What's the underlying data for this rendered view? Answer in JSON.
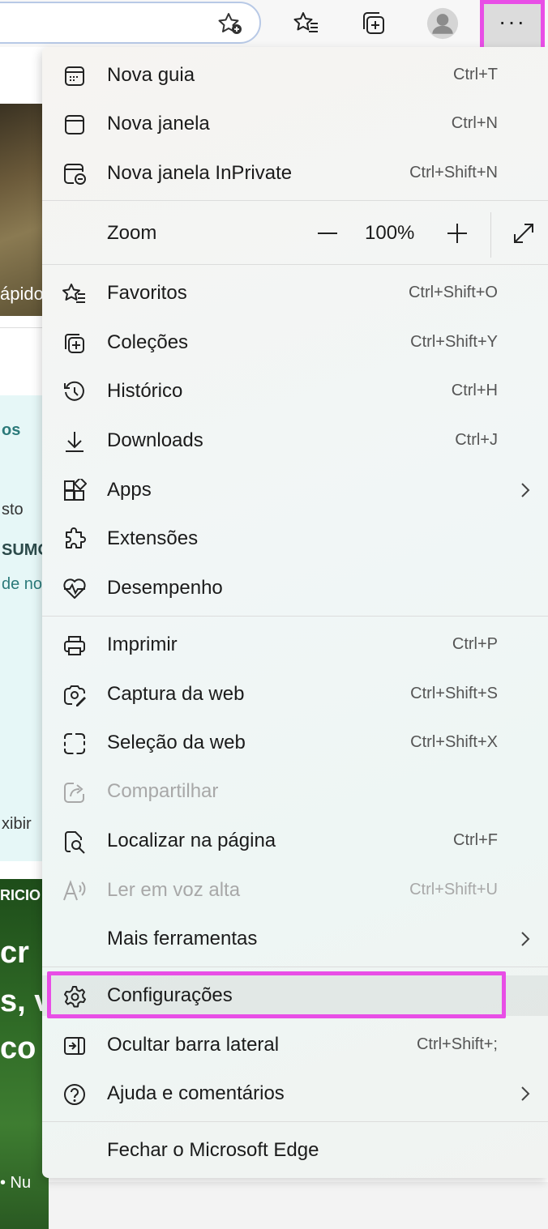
{
  "menu": {
    "items": [
      {
        "label": "Nova guia",
        "shortcut": "Ctrl+T",
        "icon": "new-tab-icon"
      },
      {
        "label": "Nova janela",
        "shortcut": "Ctrl+N",
        "icon": "new-window-icon"
      },
      {
        "label": "Nova janela InPrivate",
        "shortcut": "Ctrl+Shift+N",
        "icon": "inprivate-window-icon"
      }
    ],
    "zoom": {
      "label": "Zoom",
      "value": "100%",
      "minus": "—",
      "plus": "+"
    },
    "items2": [
      {
        "label": "Favoritos",
        "shortcut": "Ctrl+Shift+O",
        "icon": "favorites-icon"
      },
      {
        "label": "Coleções",
        "shortcut": "Ctrl+Shift+Y",
        "icon": "collections-icon"
      },
      {
        "label": "Histórico",
        "shortcut": "Ctrl+H",
        "icon": "history-icon"
      },
      {
        "label": "Downloads",
        "shortcut": "Ctrl+J",
        "icon": "downloads-icon"
      },
      {
        "label": "Apps",
        "shortcut": "",
        "icon": "apps-icon",
        "submenu": true
      },
      {
        "label": "Extensões",
        "shortcut": "",
        "icon": "extensions-icon"
      },
      {
        "label": "Desempenho",
        "shortcut": "",
        "icon": "performance-icon"
      }
    ],
    "items3": [
      {
        "label": "Imprimir",
        "shortcut": "Ctrl+P",
        "icon": "print-icon"
      },
      {
        "label": "Captura da web",
        "shortcut": "Ctrl+Shift+S",
        "icon": "web-capture-icon"
      },
      {
        "label": "Seleção da web",
        "shortcut": "Ctrl+Shift+X",
        "icon": "web-select-icon"
      },
      {
        "label": "Compartilhar",
        "shortcut": "",
        "icon": "share-icon",
        "disabled": true
      },
      {
        "label": "Localizar na página",
        "shortcut": "Ctrl+F",
        "icon": "find-icon"
      },
      {
        "label": "Ler em voz alta",
        "shortcut": "Ctrl+Shift+U",
        "icon": "read-aloud-icon",
        "disabled": true
      },
      {
        "label": "Mais ferramentas",
        "shortcut": "",
        "icon": "",
        "submenu": true
      }
    ],
    "items4": [
      {
        "label": "Configurações",
        "shortcut": "",
        "icon": "settings-icon"
      },
      {
        "label": "Ocultar barra lateral",
        "shortcut": "Ctrl+Shift+;",
        "icon": "sidebar-icon"
      },
      {
        "label": "Ajuda e comentários",
        "shortcut": "",
        "icon": "help-icon",
        "submenu": true
      }
    ],
    "close": {
      "label": "Fechar o Microsoft Edge"
    }
  },
  "toolbar": {
    "more_label": "···"
  },
  "background": {
    "photo_text": "ápido",
    "card_lines": [
      "os",
      "sto",
      "SUMO",
      "de no",
      "xibir"
    ],
    "green_lines": [
      "RICIO",
      "cr",
      "s, v",
      "co c",
      "• Nu"
    ]
  },
  "colors": {
    "highlight": "#e84ee6",
    "text": "#1b1b1b",
    "shortcut": "#555555",
    "disabled": "#a8a8a8"
  }
}
